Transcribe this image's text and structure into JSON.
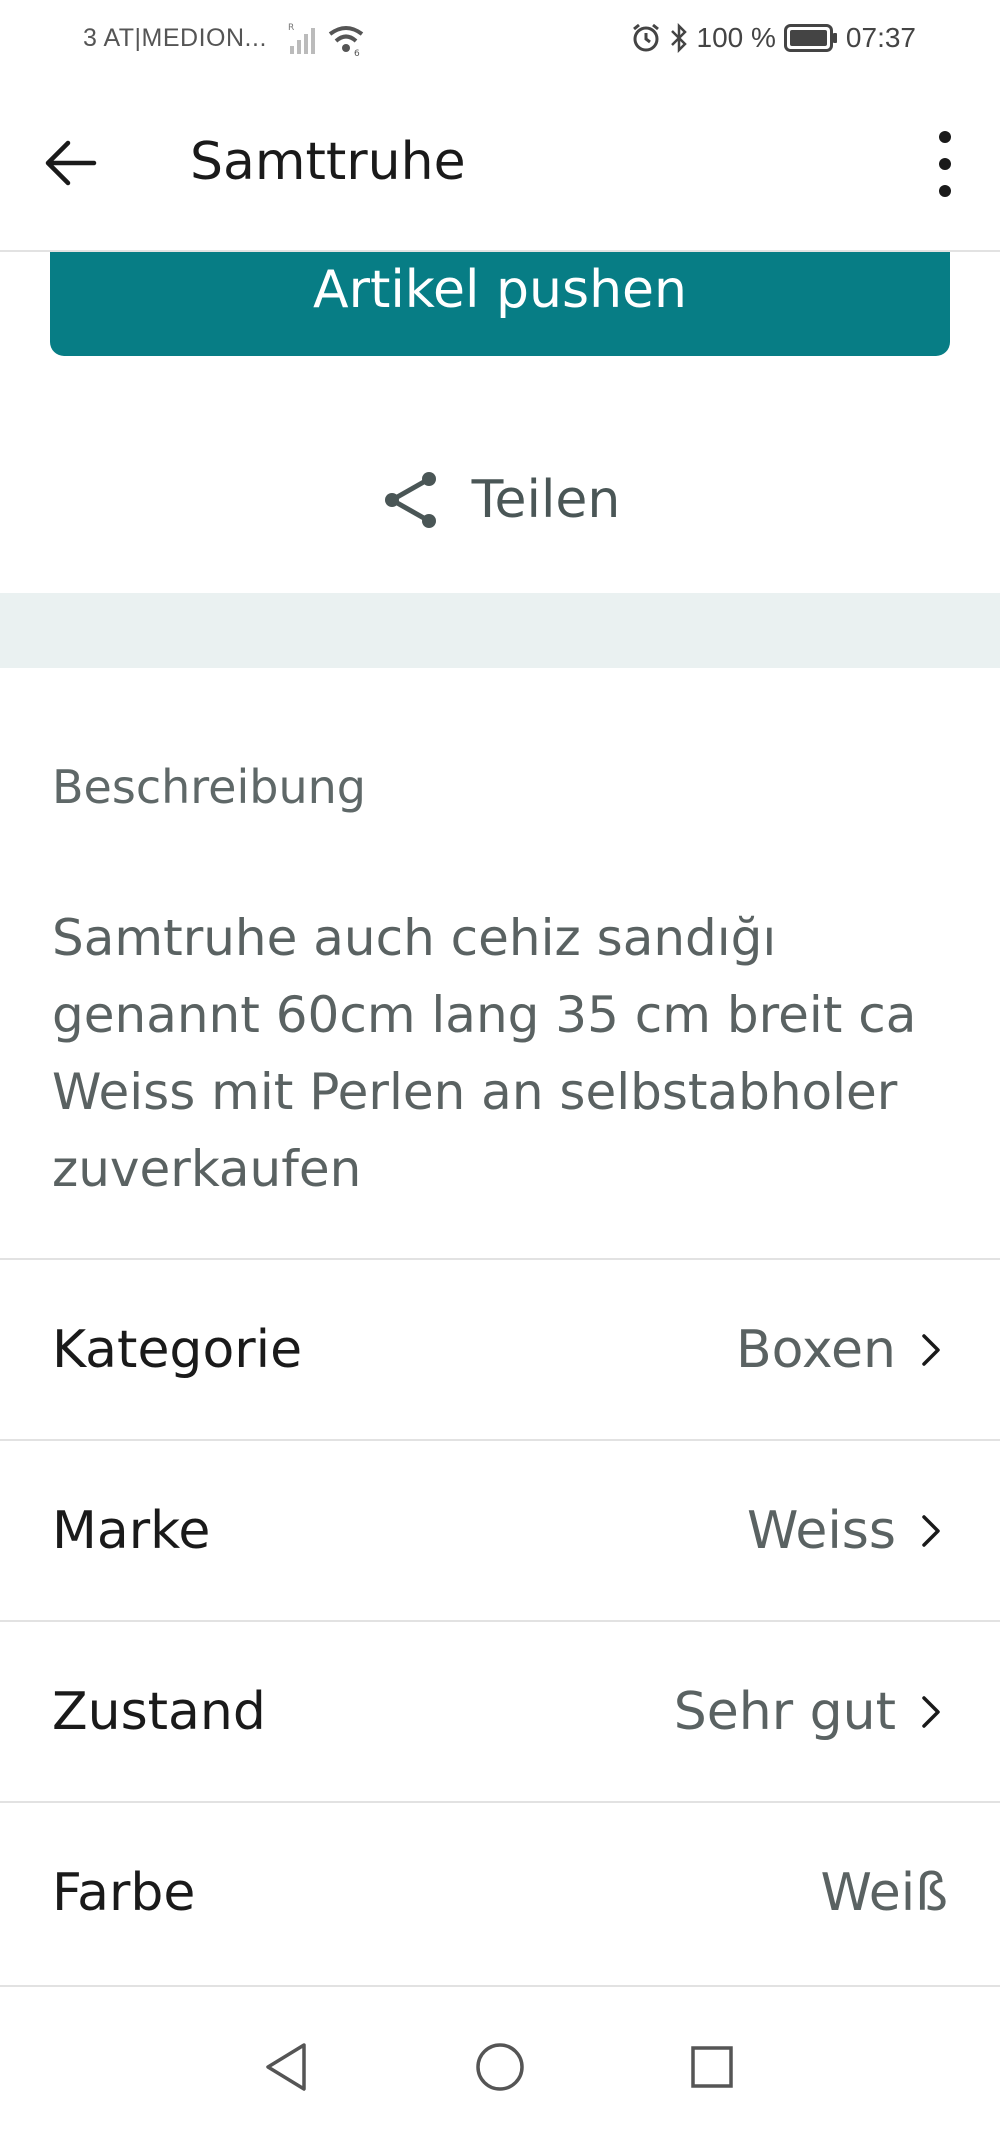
{
  "status_bar": {
    "carrier": "3 AT|MEDION...",
    "battery": "100 %",
    "time": "07:37",
    "icons": [
      "signal-icon",
      "wifi-icon",
      "alarm-icon",
      "bluetooth-icon",
      "battery-icon"
    ]
  },
  "app_bar": {
    "title": "Samttruhe",
    "back_icon": "arrow-left-icon",
    "menu_icon": "more-vert-icon"
  },
  "actions": {
    "push_label": "Artikel pushen",
    "share_label": "Teilen",
    "push_color": "#077d85"
  },
  "description": {
    "heading": "Beschreibung",
    "text": "Samtruhe auch cehiz sandığı genannt 60cm lang 35 cm breit ca Weiss mit Perlen an selbstabholer zuverkaufen"
  },
  "details": [
    {
      "label": "Kategorie",
      "value": "Boxen",
      "chevron": true
    },
    {
      "label": "Marke",
      "value": "Weiss",
      "chevron": true
    },
    {
      "label": "Zustand",
      "value": "Sehr gut",
      "chevron": true
    },
    {
      "label": "Farbe",
      "value": "Weiß",
      "chevron": false
    }
  ],
  "nav_bar": {
    "icons": [
      "nav-back-icon",
      "nav-home-icon",
      "nav-recents-icon"
    ]
  }
}
